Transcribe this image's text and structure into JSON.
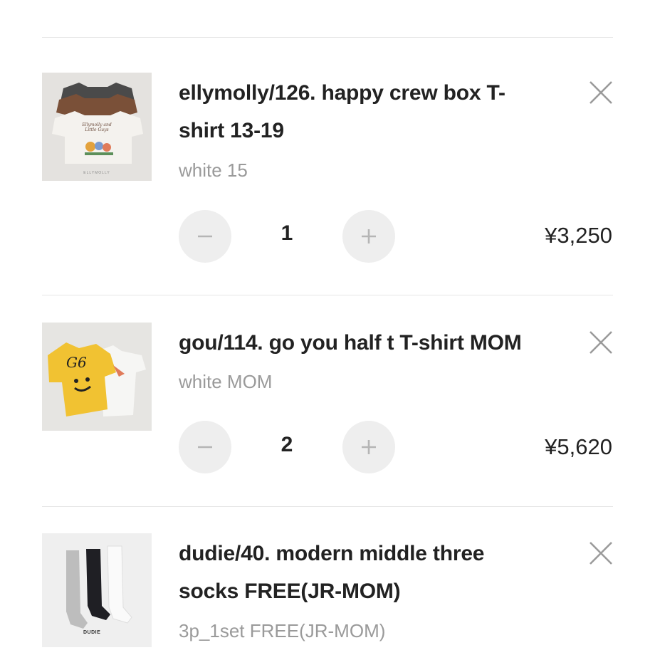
{
  "cart": {
    "items": [
      {
        "title": "ellymolly/126. happy crew box T-shirt 13-19",
        "title_line1": "ellymolly/126. happy crew box T-",
        "title_line2": "shirt 13-19",
        "variant": "white 15",
        "quantity": "1",
        "price": "¥3,250",
        "thumb_logo": "ELLYMOLLY",
        "thumb_print": "Ellymolly and Little Guys"
      },
      {
        "title": "gou/114. go you half t T-shirt MOM",
        "variant": "white MOM",
        "quantity": "2",
        "price": "¥5,620",
        "thumb_print": "G6"
      },
      {
        "title": "dudie/40. modern middle three socks FREE(JR-MOM)",
        "title_line1": "dudie/40. modern middle three",
        "title_line2": "socks FREE(JR-MOM)",
        "variant": "3p_1set FREE(JR-MOM)",
        "thumb_logo": "DUDIE"
      }
    ]
  },
  "icons": {
    "remove": "close-icon",
    "decrease": "minus-icon",
    "increase": "plus-icon"
  },
  "colors": {
    "text": "#222222",
    "muted_text": "#9a9a9a",
    "button_bg": "#eeeeee",
    "divider": "#e6e6e6"
  }
}
